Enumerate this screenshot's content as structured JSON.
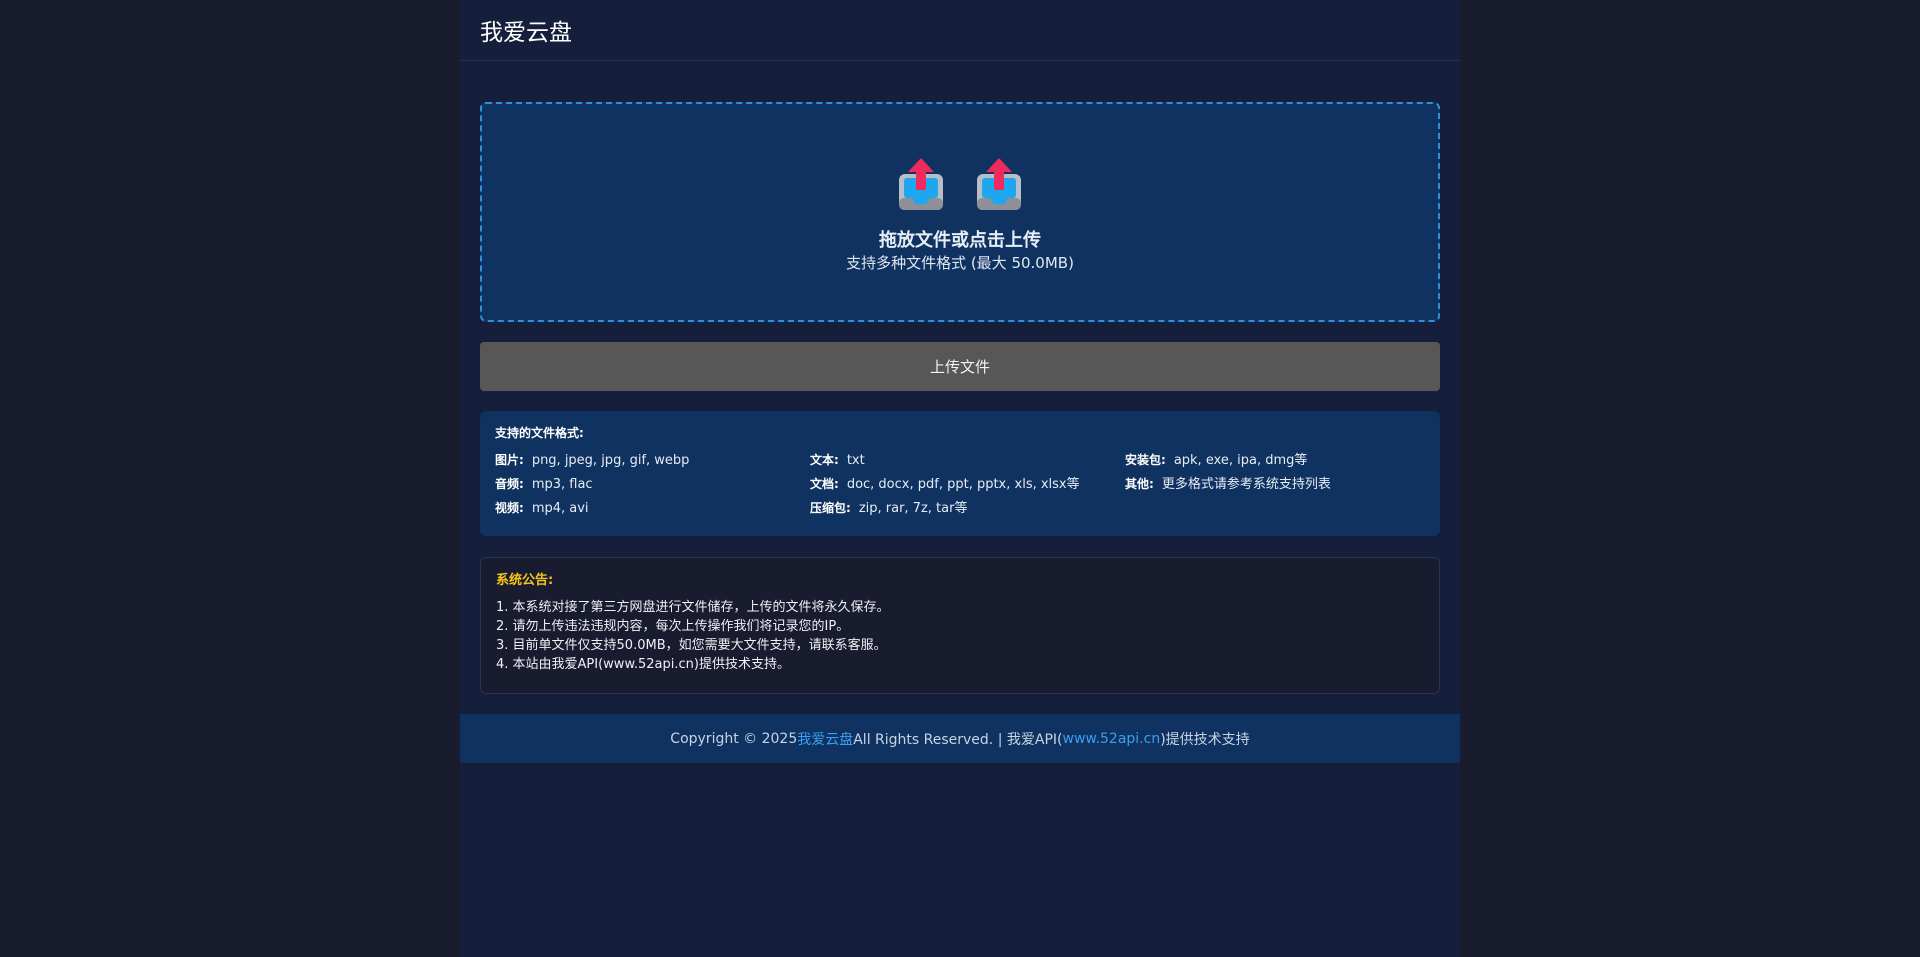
{
  "header": {
    "title": "我爱云盘"
  },
  "dropzone": {
    "title": "拖放文件或点击上传",
    "subtitle": "支持多种文件格式 (最大 50.0MB)",
    "icons": [
      "upload-tray-icon",
      "upload-tray-icon"
    ]
  },
  "upload_button": {
    "label": "上传文件"
  },
  "formats": {
    "title": "支持的文件格式:",
    "items": [
      {
        "label": "图片:",
        "value": "png, jpeg, jpg, gif, webp"
      },
      {
        "label": "文本:",
        "value": "txt"
      },
      {
        "label": "安装包:",
        "value": "apk, exe, ipa, dmg等"
      },
      {
        "label": "音频:",
        "value": "mp3, flac"
      },
      {
        "label": "文档:",
        "value": "doc, docx, pdf, ppt, pptx, xls, xlsx等"
      },
      {
        "label": "其他:",
        "value": "更多格式请参考系统支持列表"
      },
      {
        "label": "视频:",
        "value": "mp4, avi"
      },
      {
        "label": "压缩包:",
        "value": "zip, rar, 7z, tar等"
      }
    ]
  },
  "notice": {
    "title": "系统公告:",
    "lines": [
      "1. 本系统对接了第三方网盘进行文件储存，上传的文件将永久保存。",
      "2. 请勿上传违法违规内容，每次上传操作我们将记录您的IP。",
      "3. 目前单文件仅支持50.0MB，如您需要大文件支持，请联系客服。",
      "4. 本站由我爱API(www.52api.cn)提供技术支持。"
    ]
  },
  "footer": {
    "prefix": "Copyright © 2025 ",
    "site_link": "我爱云盘",
    "middle": " All Rights Reserved. | 我爱API(",
    "api_link": "www.52api.cn",
    "suffix": ")提供技术支持"
  },
  "colors": {
    "page_bg": "#191b2e",
    "content_bg": "#151f3b",
    "panel_bg": "#0f3260",
    "dropzone_border": "#2f8fd7",
    "button_bg": "#575757",
    "notice_title": "#f5c518",
    "link": "#3aa0f0"
  }
}
